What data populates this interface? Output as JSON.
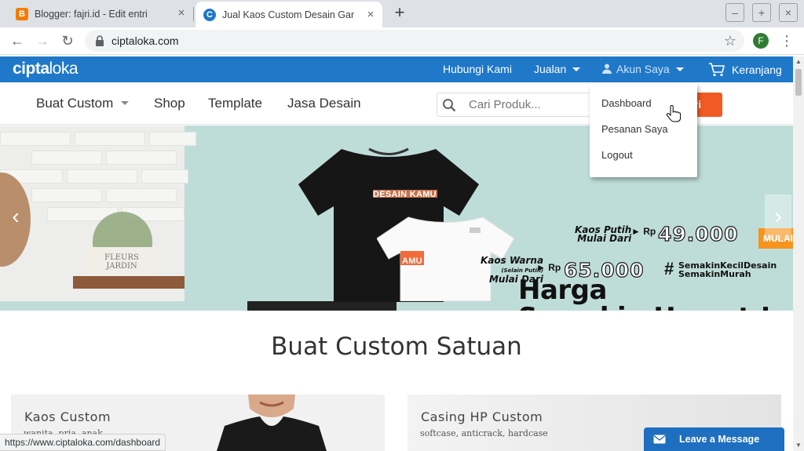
{
  "browser": {
    "tabs": [
      {
        "title": "Blogger: fajri.id - Edit entri",
        "favicon": "blogger-icon",
        "color": "#f57c00",
        "active": false
      },
      {
        "title": "Jual Kaos Custom Desain Gamb",
        "favicon": "ciptaloka-icon",
        "color": "#1f78c8",
        "active": true
      }
    ],
    "new_tab_symbol": "+",
    "tab_close_symbol": "×",
    "window_controls": {
      "minimize": "–",
      "maximize": "+",
      "close": "×"
    },
    "url": "ciptaloka.com",
    "profile_initial": "F",
    "profile_color": "#2e7d32"
  },
  "site": {
    "logo": {
      "part1": "cipta",
      "part2": "loka"
    },
    "brand_color": "#1f78c8",
    "topnav": {
      "contact": "Hubungi Kami",
      "sell": "Jualan",
      "account": "Akun Saya",
      "cart": "Keranjang"
    },
    "account_menu": [
      "Dashboard",
      "Pesanan Saya",
      "Logout"
    ],
    "mainnav": {
      "custom": "Buat Custom",
      "shop": "Shop",
      "template": "Template",
      "design_service": "Jasa Desain"
    },
    "search": {
      "placeholder": "Cari Produk...",
      "button": "ari"
    },
    "accent_color": "#f15a24"
  },
  "hero": {
    "black_tee_label": "DESAIN KAMU",
    "white_tee_label": "AMU",
    "headline_line1": "Harga",
    "headline_line2": "Semakin Hemat !",
    "price1_label_line1": "Kaos Putih",
    "price1_label_line2": "Mulai Dari",
    "price1_rp": "► Rp",
    "price1_value": "49.000",
    "price2_label_line1": "Kaos Warna",
    "price2_label_note": "(Selain Putih)",
    "price2_label_line2": "Mulai Dari",
    "price2_rp": "► Rp",
    "price2_value": "65.000",
    "hashtag_line1": "SemakinKecilDesain",
    "hashtag_line2": "SemakinMurah",
    "hashtag_symbol": "#",
    "peek_badge": "MULAI",
    "pot_text_line1": "FLEURS",
    "pot_text_line2": "JARDIN",
    "prev_symbol": "‹",
    "next_symbol": "›"
  },
  "section": {
    "title": "Buat Custom Satuan",
    "cards": [
      {
        "title": "Kaos Custom",
        "subtitle": "wanita, pria, anak"
      },
      {
        "title": "Casing HP Custom",
        "subtitle": "softcase, anticrack, hardcase"
      }
    ]
  },
  "status_url": "https://www.ciptaloka.com/dashboard",
  "chat_label": "Leave a Message"
}
